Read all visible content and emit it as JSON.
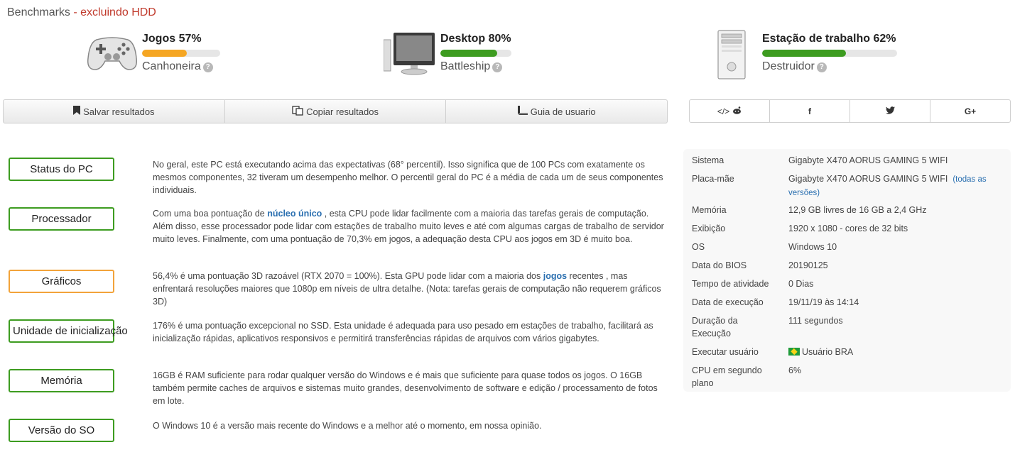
{
  "header": {
    "title": "Benchmarks",
    "subtitle": " - excluindo HDD"
  },
  "benchmarks": [
    {
      "title": "Jogos 57%",
      "rating": "Canhoneira",
      "percent": 57,
      "color": "#f5a623",
      "icon": "gamepad-icon"
    },
    {
      "title": "Desktop 80%",
      "rating": "Battleship",
      "percent": 80,
      "color": "#3d9c20",
      "icon": "monitor-icon"
    },
    {
      "title": "Estação de trabalho 62%",
      "rating": "Destruidor",
      "percent": 62,
      "color": "#3d9c20",
      "icon": "workstation-tower-icon"
    }
  ],
  "help_mark": "?",
  "toolbar": {
    "save": "Salvar resultados",
    "copy": "Copiar resultados",
    "guide": "Guia de usuario"
  },
  "social": {
    "embed": "</>",
    "facebook": "f",
    "twitter": "t",
    "gplus": "G+"
  },
  "sections": [
    {
      "label": "Status do PC",
      "status": "green",
      "text": "No geral, este PC está executando acima das expectativas (68° percentil). Isso significa que de 100 PCs com exatamente os mesmos componentes, 32 tiveram um desempenho melhor. O percentil geral do PC é a média de cada um de seus componentes individuais."
    },
    {
      "label": "Processador",
      "status": "green",
      "text_before": "Com uma boa pontuação de ",
      "link": "núcleo único",
      "text_after": " , esta CPU pode lidar facilmente com a maioria das tarefas gerais de computação. Além disso, esse processador pode lidar com estações de trabalho muito leves e até com algumas cargas de trabalho de servidor muito leves. Finalmente, com uma pontuação de 70,3% em jogos, a adequação desta CPU aos jogos em 3D é muito boa."
    },
    {
      "label": "Gráficos",
      "status": "orange",
      "text_before": "56,4% é uma pontuação 3D razoável (RTX 2070 = 100%). Esta GPU pode lidar com a maioria dos ",
      "link": "jogos",
      "text_after": " recentes , mas enfrentará resoluções maiores que 1080p em níveis de ultra detalhe. (Nota: tarefas gerais de computação não requerem gráficos 3D)"
    },
    {
      "label": "Unidade de inicialização",
      "status": "green",
      "text": "176% é uma pontuação excepcional no SSD. Esta unidade é adequada para uso pesado em estações de trabalho, facilitará as inicialização rápidas, aplicativos responsivos e permitirá transferências rápidas de arquivos com vários gigabytes."
    },
    {
      "label": "Memória",
      "status": "green",
      "text": "16GB é RAM suficiente para rodar qualquer versão do Windows e é mais que suficiente para quase todos os jogos. O 16GB também permite caches de arquivos e sistemas muito grandes, desenvolvimento de software e edição / processamento de fotos em lote."
    },
    {
      "label": "Versão do SO",
      "status": "green",
      "text": "O Windows 10 é a versão mais recente do Windows e a melhor até o momento, em nossa opinião."
    }
  ],
  "system_info": {
    "rows": [
      {
        "key": "Sistema",
        "value": "Gigabyte X470 AORUS GAMING 5 WIFI"
      },
      {
        "key": "Placa-mãe",
        "value": "Gigabyte X470 AORUS GAMING 5 WIFI",
        "extra": "(todas as versões)"
      },
      {
        "key": "Memória",
        "value": "12,9 GB livres de 16 GB a 2,4 GHz"
      },
      {
        "key": "Exibição",
        "value": "1920 x 1080 - cores de 32 bits"
      },
      {
        "key": "OS",
        "value": "Windows 10"
      },
      {
        "key": "Data do BIOS",
        "value": "20190125"
      },
      {
        "key": "Tempo de atividade",
        "value": "0 Dias"
      },
      {
        "key": "Data de execução",
        "value": "19/11/19 às 14:14"
      },
      {
        "key": "Duração da Execução",
        "value": "111 segundos"
      },
      {
        "key": "Executar usuário",
        "value": "Usuário BRA",
        "flag": "brazil-flag-icon"
      },
      {
        "key": "CPU em segundo plano",
        "value": "6%"
      }
    ]
  }
}
